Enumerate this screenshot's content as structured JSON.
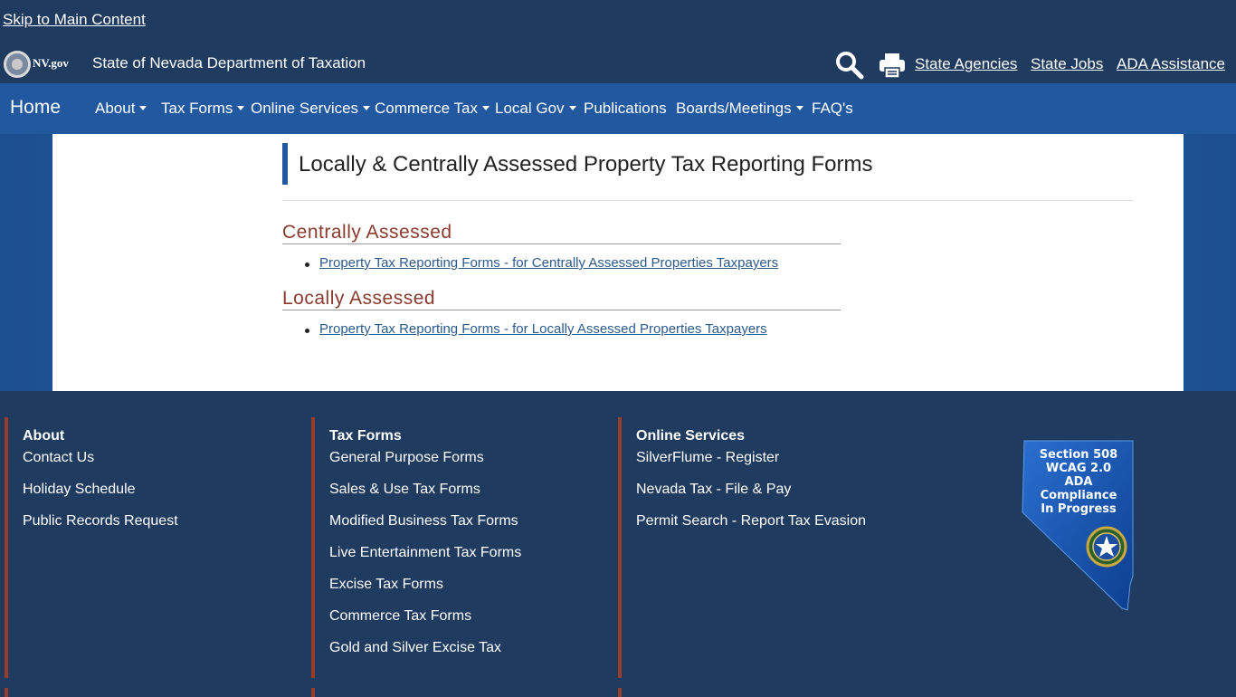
{
  "skip_link": "Skip to Main Content",
  "brand": {
    "nvgov": "NV.gov",
    "agency": "State of Nevada Department of Taxation"
  },
  "utility_links": [
    "State Agencies",
    "State Jobs",
    "ADA Assistance"
  ],
  "nav": {
    "home": "Home",
    "items": [
      {
        "label": "About",
        "dropdown": true
      },
      {
        "label": "Tax Forms",
        "dropdown": true
      },
      {
        "label": "Online Services",
        "dropdown": true
      },
      {
        "label": "Commerce Tax",
        "dropdown": true
      },
      {
        "label": "Local Gov",
        "dropdown": true
      },
      {
        "label": "Publications",
        "dropdown": false
      },
      {
        "label": "Boards/Meetings",
        "dropdown": true
      },
      {
        "label": "FAQ's",
        "dropdown": false
      }
    ]
  },
  "main": {
    "title": "Locally & Centrally Assessed Property Tax Reporting Forms",
    "sections": [
      {
        "heading": "Centrally Assessed",
        "links": [
          "Property Tax Reporting Forms - for Centrally Assessed Properties Taxpayers"
        ]
      },
      {
        "heading": "Locally Assessed",
        "links": [
          "Property Tax Reporting Forms - for Locally Assessed Properties Taxpayers"
        ]
      }
    ]
  },
  "footer": {
    "columns": [
      {
        "heading": "About",
        "links": [
          "Contact Us",
          "Holiday Schedule",
          "Public Records Request"
        ]
      },
      {
        "heading": "Tax Forms",
        "links": [
          "General Purpose Forms",
          "Sales & Use Tax Forms",
          "Modified Business Tax Forms",
          "Live Entertainment Tax Forms",
          "Excise Tax Forms",
          "Commerce Tax Forms",
          "Gold and Silver Excise Tax"
        ]
      },
      {
        "heading": "Online Services",
        "links": [
          "SilverFlume - Register",
          "Nevada Tax - File & Pay",
          "Permit Search - Report Tax Evasion"
        ]
      }
    ],
    "ada_badge": {
      "lines": [
        "Section 508",
        "WCAG 2.0",
        "ADA",
        "Compliance",
        "In Progress"
      ]
    }
  },
  "colors": {
    "header_bg": "#1f3b5f",
    "nav_bg": "#2158a0",
    "section_heading": "#8b3a2e",
    "link": "#2c5a8c",
    "footer_bar": "#9b3b2a"
  }
}
